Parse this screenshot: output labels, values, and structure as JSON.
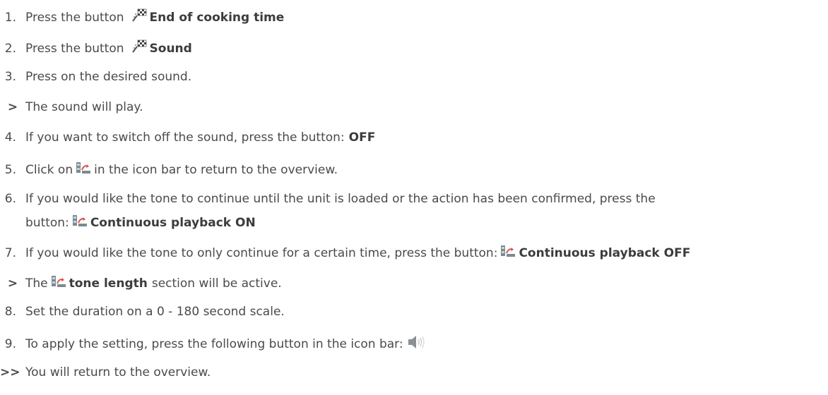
{
  "steps": [
    {
      "marker": "1.",
      "pre": "Press the button",
      "icon": "checkered-flag-icon",
      "bold": "End of cooking time"
    },
    {
      "marker": "2.",
      "pre": "Press the button",
      "icon": "checkered-flag-icon",
      "bold": "Sound"
    },
    {
      "marker": "3.",
      "pre": "Press on the desired sound."
    },
    {
      "marker": ">",
      "pre": "The sound will play."
    },
    {
      "marker": "4.",
      "pre": "If you want to switch off the sound, press the button:",
      "bold": "OFF"
    },
    {
      "marker": "5.",
      "pre": "Click on",
      "icon": "continuous-playback-icon",
      "post": "in the icon bar to return to the overview."
    },
    {
      "marker": "6.",
      "pre": "If you would like the tone to continue until the unit is loaded or the action has been confirmed, press the",
      "pre2": "button:",
      "icon": "continuous-playback-icon",
      "bold": "Continuous playback ON"
    },
    {
      "marker": "7.",
      "pre": "If you would like the tone to only continue for a certain time, press the button:",
      "icon": "continuous-playback-icon",
      "bold": "Continuous playback OFF"
    },
    {
      "marker": ">",
      "pre": "The",
      "icon": "continuous-playback-icon",
      "bold": "tone length",
      "post": "section will be active."
    },
    {
      "marker": "8.",
      "pre": "Set the duration on a 0 - 180 second scale."
    },
    {
      "marker": "9.",
      "pre": "To apply the setting, press the following button in the icon bar:",
      "icon": "speaker-icon"
    },
    {
      "marker": ">>",
      "pre": "You will return to the overview."
    }
  ]
}
